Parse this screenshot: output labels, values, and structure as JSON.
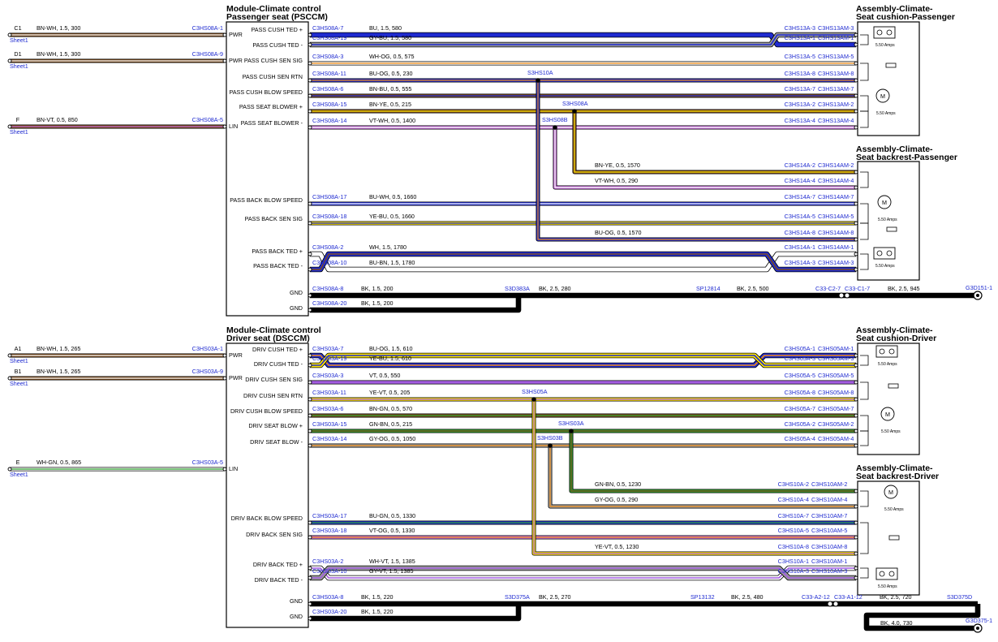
{
  "modules": [
    {
      "title1": "Module-Climate control",
      "title2": "Passenger seat (PSCCM)"
    },
    {
      "title1": "Module-Climate control",
      "title2": "Driver seat (DSCCM)"
    }
  ],
  "assemblies": [
    {
      "title1": "Assembly-Climate-",
      "title2": "Seat cushion-Passenger"
    },
    {
      "title1": "Assembly-Climate-",
      "title2": "Seat backrest-Passenger"
    },
    {
      "title1": "Assembly-Climate-",
      "title2": "Seat cushion-Driver"
    },
    {
      "title1": "Assembly-Climate-",
      "title2": "Seat backrest-Driver"
    }
  ],
  "amps_label": "5.50 Amps",
  "motor_label": "M",
  "sheet_label": "Sheet1",
  "left_feeds": [
    {
      "id": "C1",
      "wire": "BN-WH,  1.5,  300",
      "conn": "C3HS08A-1",
      "pin": "PWR",
      "color": "#7a4a1e",
      "stripe": "#ffffff"
    },
    {
      "id": "D1",
      "wire": "BN-WH,  1.5,  300",
      "conn": "C3HS08A-9",
      "pin": "PWR",
      "color": "#7a4a1e",
      "stripe": "#ffffff"
    },
    {
      "id": "F",
      "wire": "BN-VT,  0.5,  850",
      "conn": "C3HS08A-5",
      "pin": "LIN",
      "color": "#7a4a1e",
      "stripe": "#c36bd6"
    },
    {
      "id": "A1",
      "wire": "BN-WH,  1.5,  265",
      "conn": "C3HS03A-1",
      "pin": "PWR",
      "color": "#7a4a1e",
      "stripe": "#ffffff"
    },
    {
      "id": "B1",
      "wire": "BN-WH,  1.5,  265",
      "conn": "C3HS03A-9",
      "pin": "PWR",
      "color": "#7a4a1e",
      "stripe": "#ffffff"
    },
    {
      "id": "E",
      "wire": "WH-GN,  0.5,  865",
      "conn": "C3HS03A-5",
      "pin": "LIN",
      "color": "#ffffff",
      "stripe": "#2ea02e"
    }
  ],
  "pin_labels": [
    "PASS CUSH TED +",
    "PASS CUSH TED -",
    "PASS CUSH SEN SIG",
    "PASS CUSH SEN RTN",
    "PASS CUSH BLOW SPEED",
    "PASS SEAT BLOWER +",
    "PASS SEAT BLOWER -",
    "PASS BACK BLOW SPEED",
    "PASS BACK SEN SIG",
    "PASS BACK TED +",
    "PASS BACK TED -",
    "GND",
    "GND",
    "DRIV CUSH TED +",
    "DRIV CUSH TED -",
    "DRIV CUSH SEN SIG",
    "DRIV CUSH SEN RTN",
    "DRIV CUSH BLOW SPEED",
    "DRIV SEAT BLOW +",
    "DRIV SEAT BLOW -",
    "DRIV BACK BLOW SPEED",
    "DRIV BACK SEN SIG",
    "DRIV BACK TED +",
    "DRIV BACK TED -",
    "GND",
    "GND"
  ],
  "wires": [
    {
      "lc": "C3HS08A-7",
      "w": "BU,  1.5,  580",
      "rc": "C3HS13A-1",
      "rc2": "C3HS13AM-1",
      "color": "#1f2bd0",
      "stripe": ""
    },
    {
      "lc": "C3HS08A-19",
      "w": "GY-BU,  1.5,  580",
      "rc": "C3HS13A-3",
      "rc2": "C3HS13AM-3",
      "color": "#9a9a9a",
      "stripe": "#1f2bd0"
    },
    {
      "lc": "C3HS08A-3",
      "w": "WH-OG,  0.5,  575",
      "rc": "C3HS13A-5",
      "rc2": "C3HS13AM-5",
      "color": "#ffffff",
      "stripe": "#f08c14"
    },
    {
      "lc": "C3HS08A-11",
      "w": "BU-OG,  0.5,  230",
      "rc": "C3HS13A-8",
      "rc2": "C3HS13AM-8",
      "color": "#1f2bd0",
      "stripe": "#f08c14"
    },
    {
      "lc": "C3HS08A-6",
      "w": "BN-BU,  0.5,  555",
      "rc": "C3HS13A-7",
      "rc2": "C3HS13AM-7",
      "color": "#7a4a1e",
      "stripe": "#1f2bd0"
    },
    {
      "lc": "C3HS08A-15",
      "w": "BN-YE,  0.5,  215",
      "rc": "C3HS13A-2",
      "rc2": "C3HS13AM-2",
      "color": "#7a4a1e",
      "stripe": "#ffe600"
    },
    {
      "lc": "C3HS08A-14",
      "w": "VT-WH,  0.5,  1400",
      "rc": "C3HS13A-4",
      "rc2": "C3HS13AM-4",
      "color": "#c36bd6",
      "stripe": "#ffffff"
    },
    {
      "lc": "",
      "w": "BN-YE,  0.5,  1570",
      "rc": "C3HS14A-2",
      "rc2": "C3HS14AM-2",
      "color": "#7a4a1e",
      "stripe": "#ffe600"
    },
    {
      "lc": "",
      "w": "VT-WH,  0.5,  290",
      "rc": "C3HS14A-4",
      "rc2": "C3HS14AM-4",
      "color": "#c36bd6",
      "stripe": "#ffffff"
    },
    {
      "lc": "C3HS08A-17",
      "w": "BU-WH,  0.5,  1660",
      "rc": "C3HS14A-7",
      "rc2": "C3HS14AM-7",
      "color": "#1f2bd0",
      "stripe": "#ffffff"
    },
    {
      "lc": "C3HS08A-18",
      "w": "YE-BU,  0.5,  1660",
      "rc": "C3HS14A-5",
      "rc2": "C3HS14AM-5",
      "color": "#ffe600",
      "stripe": "#1f2bd0"
    },
    {
      "lc": "",
      "w": "BU-OG,  0.5,  1570",
      "rc": "C3HS14A-8",
      "rc2": "C3HS14AM-8",
      "color": "#1f2bd0",
      "stripe": "#f08c14"
    },
    {
      "lc": "C3HS08A-2",
      "w": "WH,  1.5,  1780",
      "rc": "C3HS14A-1",
      "rc2": "C3HS14AM-1",
      "color": "#ffffff",
      "stripe": ""
    },
    {
      "lc": "C3HS08A-10",
      "w": "BU-BN,  1.5,  1780",
      "rc": "C3HS14A-3",
      "rc2": "C3HS14AM-3",
      "color": "#1f2bd0",
      "stripe": "#7a4a1e"
    },
    {
      "lc": "C3HS03A-7",
      "w": "BU-OG,  1.5,  610",
      "rc": "C3HS05A-1",
      "rc2": "C3HS05AM-1",
      "color": "#1f2bd0",
      "stripe": "#f08c14"
    },
    {
      "lc": "C3HS03A-19",
      "w": "YE-BU,  1.5,  610",
      "rc": "C3HS05A-3",
      "rc2": "C3HS05AM-3",
      "color": "#ffe600",
      "stripe": "#1f2bd0"
    },
    {
      "lc": "C3HS03A-3",
      "w": "VT,  0.5,  550",
      "rc": "C3HS05A-5",
      "rc2": "C3HS05AM-5",
      "color": "#a35ce0",
      "stripe": ""
    },
    {
      "lc": "C3HS03A-11",
      "w": "YE-VT,  0.5,  205",
      "rc": "C3HS05A-8",
      "rc2": "C3HS05AM-8",
      "color": "#ffe600",
      "stripe": "#a35ce0"
    },
    {
      "lc": "C3HS03A-6",
      "w": "BN-GN,  0.5,  570",
      "rc": "C3HS05A-7",
      "rc2": "C3HS05AM-7",
      "color": "#7a4a1e",
      "stripe": "#2ea02e"
    },
    {
      "lc": "C3HS03A-15",
      "w": "GN-BN,  0.5,  215",
      "rc": "C3HS05A-2",
      "rc2": "C3HS05AM-2",
      "color": "#2ea02e",
      "stripe": "#7a4a1e"
    },
    {
      "lc": "C3HS03A-14",
      "w": "GY-OG,  0.5,  1050",
      "rc": "C3HS05A-4",
      "rc2": "C3HS05AM-4",
      "color": "#9a9a9a",
      "stripe": "#f08c14"
    },
    {
      "lc": "",
      "w": "GN-BN,  0.5,  1230",
      "rc": "C3HS10A-2",
      "rc2": "C3HS10AM-2",
      "color": "#2ea02e",
      "stripe": "#7a4a1e"
    },
    {
      "lc": "",
      "w": "GY-OG,  0.5,  290",
      "rc": "C3HS10A-4",
      "rc2": "C3HS10AM-4",
      "color": "#9a9a9a",
      "stripe": "#f08c14"
    },
    {
      "lc": "C3HS03A-17",
      "w": "BU-GN,  0.5,  1330",
      "rc": "C3HS10A-7",
      "rc2": "C3HS10AM-7",
      "color": "#1f2bd0",
      "stripe": "#2ea02e"
    },
    {
      "lc": "C3HS03A-18",
      "w": "VT-OG,  0.5,  1330",
      "rc": "C3HS10A-5",
      "rc2": "C3HS10AM-5",
      "color": "#c36bd6",
      "stripe": "#f08c14"
    },
    {
      "lc": "",
      "w": "YE-VT,  0.5,  1230",
      "rc": "C3HS10A-8",
      "rc2": "C3HS10AM-8",
      "color": "#ffe600",
      "stripe": "#a35ce0"
    },
    {
      "lc": "C3HS03A-2",
      "w": "WH-VT,  1.5,  1385",
      "rc": "C3HS10A-1",
      "rc2": "C3HS10AM-1",
      "color": "#ffffff",
      "stripe": "#a35ce0"
    },
    {
      "lc": "C3HS03A-10",
      "w": "GY-VT,  1.5,  1385",
      "rc": "C3HS10A-3",
      "rc2": "C3HS10AM-3",
      "color": "#9a9a9a",
      "stripe": "#a35ce0"
    }
  ],
  "splices": [
    "S3HS10A",
    "S3HS08A",
    "S3HS08B",
    "S3HS05A",
    "S3HS03A",
    "S3HS03B"
  ],
  "grounds": {
    "pass": {
      "lc1": "C3HS08A-8",
      "w1": "BK,  1.5,  200",
      "lc2": "C3HS08A-20",
      "w2": "BK,  1.5,  200",
      "splice": "S3D383A",
      "w3": "BK,  2.5,  280",
      "sp": "SP12814",
      "w4": "BK,  2.5,  500",
      "c1": "C33-C2-7",
      "c2": "C33-C1-7",
      "w5": "BK,  2.5,  945",
      "g": "G3D151-1"
    },
    "driv": {
      "lc1": "C3HS03A-8",
      "w1": "BK,  1.5,  220",
      "lc2": "C3HS03A-20",
      "w2": "BK,  1.5,  220",
      "splice": "S3D375A",
      "w3": "BK,  2.5,  270",
      "sp": "SP13132",
      "w4": "BK,  2.5,  480",
      "c1": "C33-A2-12",
      "c2": "C33-A1-12",
      "w5": "BK,  2.5,  720",
      "splice2": "S3D375D",
      "w6": "BK,  4.0,  730",
      "g": "G3D375-1"
    }
  }
}
